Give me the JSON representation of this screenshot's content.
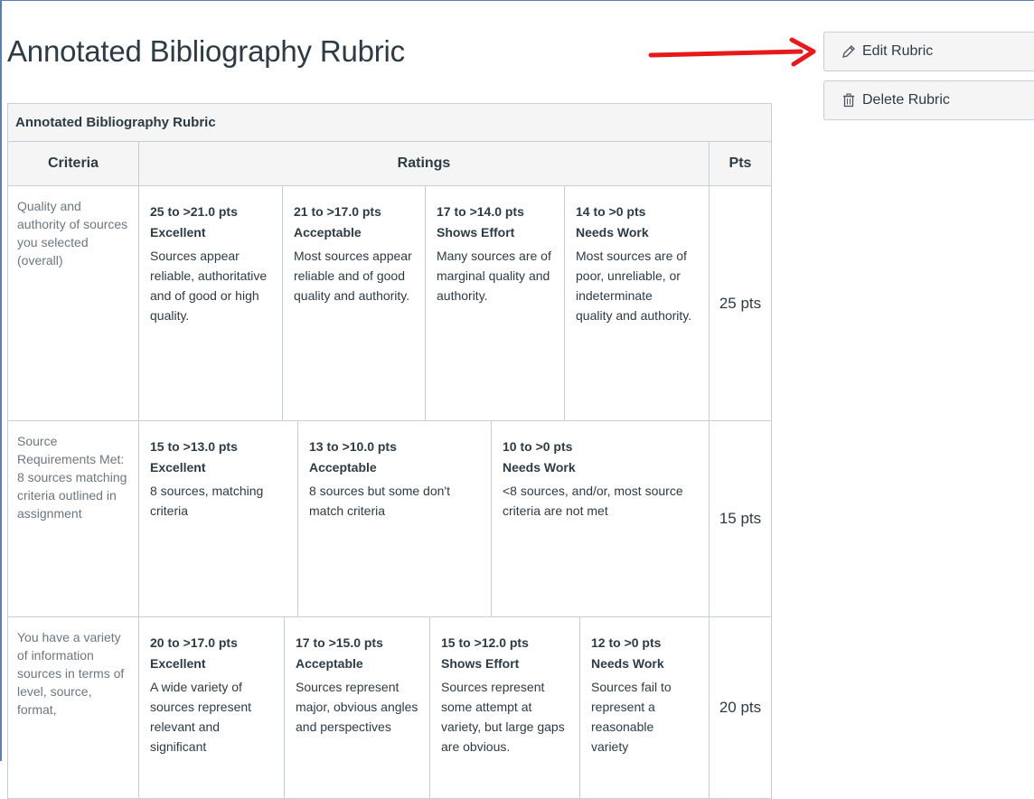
{
  "page_title": "Annotated Bibliography Rubric",
  "buttons": {
    "edit_label": "Edit Rubric",
    "delete_label": "Delete Rubric"
  },
  "colors": {
    "arrow": "#e8191c",
    "border": "#c7cdd1",
    "header_bg": "#f5f5f5"
  },
  "rubric": {
    "caption": "Annotated Bibliography Rubric",
    "headers": {
      "criteria": "Criteria",
      "ratings": "Ratings",
      "pts": "Pts"
    },
    "rows": [
      {
        "criterion": "Quality and authority of sources you selected (overall)",
        "points": "25 pts",
        "ratings": [
          {
            "pts": "25 to >21.0 pts",
            "title": "Excellent",
            "desc": "Sources appear reliable, authoritative and of good or high quality."
          },
          {
            "pts": "21 to >17.0 pts",
            "title": "Acceptable",
            "desc": "Most sources appear reliable and of good quality and authority."
          },
          {
            "pts": "17 to >14.0 pts",
            "title": "Shows Effort",
            "desc": "Many sources are of marginal quality and authority."
          },
          {
            "pts": "14 to >0 pts",
            "title": "Needs Work",
            "desc": "Most sources are of poor, unreliable, or indeterminate quality and authority."
          }
        ]
      },
      {
        "criterion": "Source Requirements Met: 8 sources matching criteria outlined in assignment",
        "points": "15 pts",
        "ratings": [
          {
            "pts": "15 to >13.0 pts",
            "title": "Excellent",
            "desc": "8 sources, matching criteria"
          },
          {
            "pts": "13 to >10.0 pts",
            "title": "Acceptable",
            "desc": "8 sources but some don't match criteria"
          },
          {
            "pts": "10 to >0 pts",
            "title": "Needs Work",
            "desc": "<8 sources, and/or, most source criteria are not met"
          }
        ]
      },
      {
        "criterion": "You have a variety of information sources in terms of level, source, format,",
        "points": "20 pts",
        "ratings": [
          {
            "pts": "20 to >17.0 pts",
            "title": "Excellent",
            "desc": "A wide variety of sources represent relevant and significant"
          },
          {
            "pts": "17 to >15.0 pts",
            "title": "Acceptable",
            "desc": "Sources represent major, obvious angles and perspectives"
          },
          {
            "pts": "15 to >12.0 pts",
            "title": "Shows Effort",
            "desc": "Sources represent some attempt at variety, but large gaps are obvious."
          },
          {
            "pts": "12 to >0 pts",
            "title": "Needs Work",
            "desc": "Sources fail to represent a reasonable variety"
          }
        ]
      }
    ]
  }
}
